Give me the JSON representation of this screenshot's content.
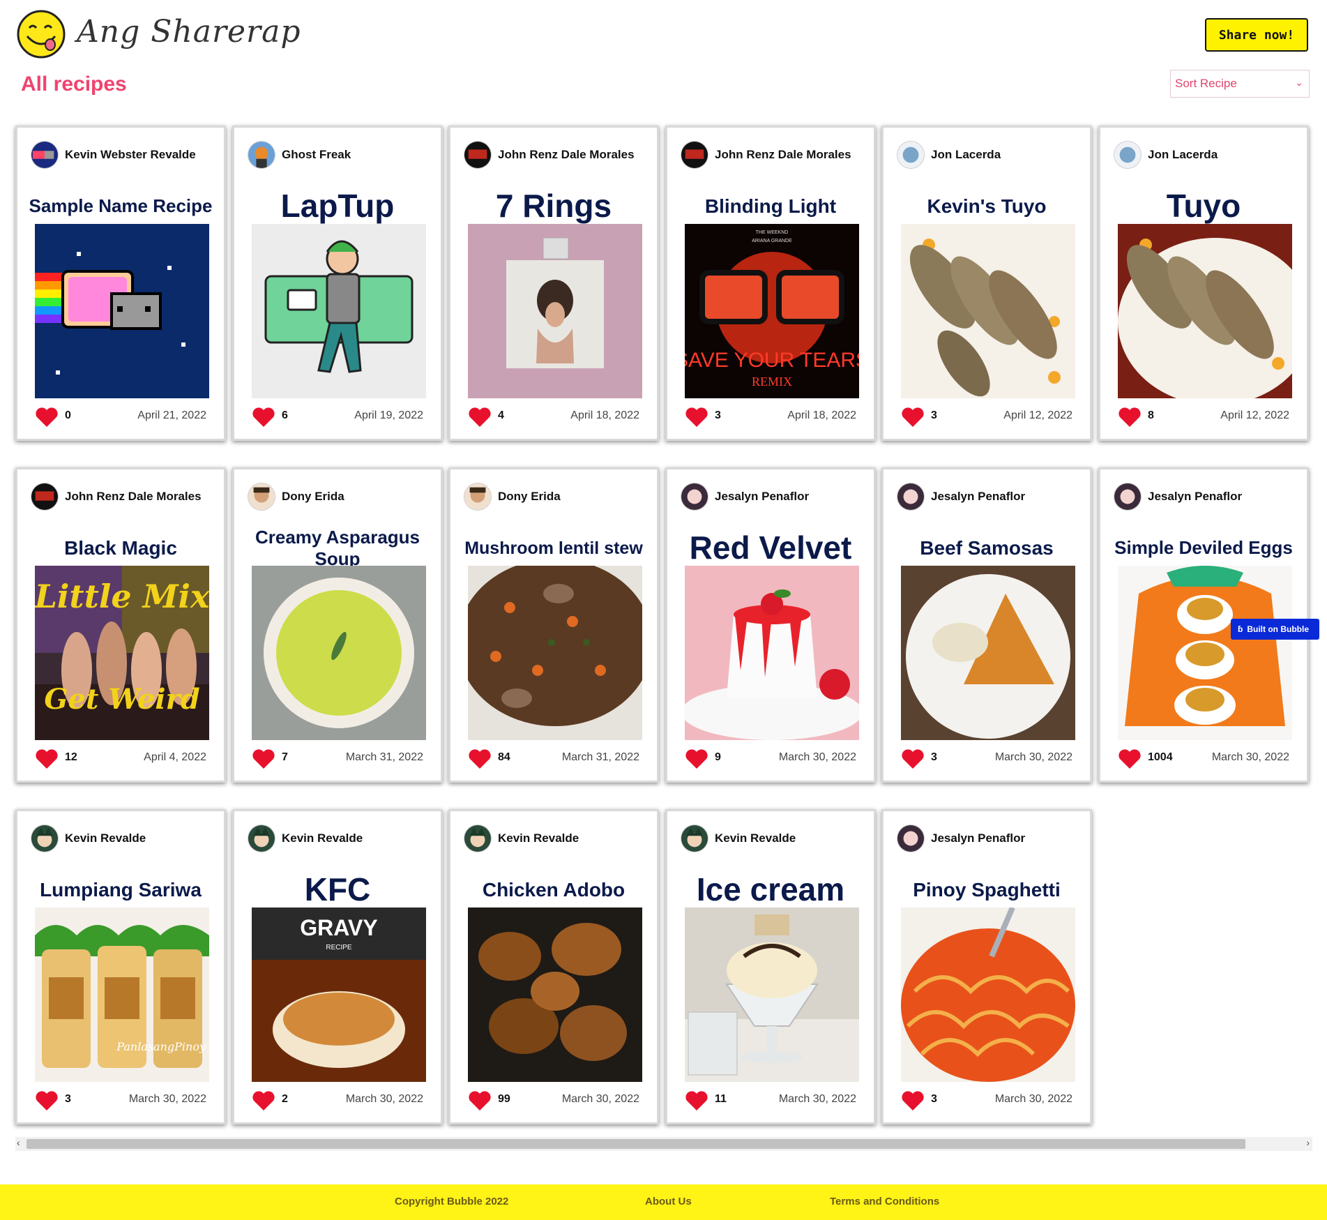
{
  "header": {
    "brand": "Ang Sharerap",
    "share_button": "Share now!"
  },
  "main": {
    "title": "All recipes",
    "sort_placeholder": "Sort Recipe"
  },
  "recipes": [
    {
      "author": "Kevin Webster Revalde",
      "title": "Sample Name Recipe",
      "likes": "0",
      "date": "April 21, 2022"
    },
    {
      "author": "Ghost Freak",
      "title": "LapTup",
      "likes": "6",
      "date": "April 19, 2022"
    },
    {
      "author": "John Renz Dale Morales",
      "title": "7 Rings",
      "likes": "4",
      "date": "April 18, 2022"
    },
    {
      "author": "John Renz Dale Morales",
      "title": "Blinding Light",
      "likes": "3",
      "date": "April 18, 2022"
    },
    {
      "author": "Jon Lacerda",
      "title": "Kevin's Tuyo",
      "likes": "3",
      "date": "April 12, 2022"
    },
    {
      "author": "Jon Lacerda",
      "title": "Tuyo",
      "likes": "8",
      "date": "April 12, 2022"
    },
    {
      "author": "John Renz Dale Morales",
      "title": "Black Magic",
      "likes": "12",
      "date": "April 4, 2022"
    },
    {
      "author": "Dony Erida",
      "title": "Creamy Asparagus Soup",
      "likes": "7",
      "date": "March 31, 2022"
    },
    {
      "author": "Dony Erida",
      "title": "Mushroom lentil stew",
      "likes": "84",
      "date": "March 31, 2022"
    },
    {
      "author": "Jesalyn Penaflor",
      "title": "Red Velvet",
      "likes": "9",
      "date": "March 30, 2022"
    },
    {
      "author": "Jesalyn Penaflor",
      "title": "Beef Samosas",
      "likes": "3",
      "date": "March 30, 2022"
    },
    {
      "author": "Jesalyn Penaflor",
      "title": "Simple Deviled Eggs",
      "likes": "1004",
      "date": "March 30, 2022"
    },
    {
      "author": "Kevin Revalde",
      "title": "Lumpiang Sariwa",
      "likes": "3",
      "date": "March 30, 2022"
    },
    {
      "author": "Kevin Revalde",
      "title": "KFC",
      "likes": "2",
      "date": "March 30, 2022"
    },
    {
      "author": "Kevin Revalde",
      "title": "Chicken Adobo",
      "likes": "99",
      "date": "March 30, 2022"
    },
    {
      "author": "Kevin Revalde",
      "title": "Ice cream",
      "likes": "11",
      "date": "March 30, 2022"
    },
    {
      "author": "Jesalyn Penaflor",
      "title": "Pinoy Spaghetti",
      "likes": "3",
      "date": "March 30, 2022"
    }
  ],
  "image_text": {
    "gravy_title": "GRAVY",
    "gravy_sub": "RECIPE",
    "save_tears": "SAVE YOUR TEARS",
    "remix": "REMIX",
    "weeknd": "THE WEEKND",
    "ariana": "ARIANA GRANDE",
    "little_mix": "Little Mix",
    "get_weird": "Get Weird",
    "panlasang": "PanlasangPinoy"
  },
  "badge": {
    "label": "Built on Bubble"
  },
  "footer": {
    "copyright": "Copyright Bubble 2022",
    "about": "About Us",
    "terms": "Terms and Conditions"
  },
  "colors": {
    "accent": "#f0436e",
    "yellow": "#fff416",
    "navy": "#0b1a4a",
    "heart": "#e8112d",
    "bubble": "#0a2ad8"
  }
}
